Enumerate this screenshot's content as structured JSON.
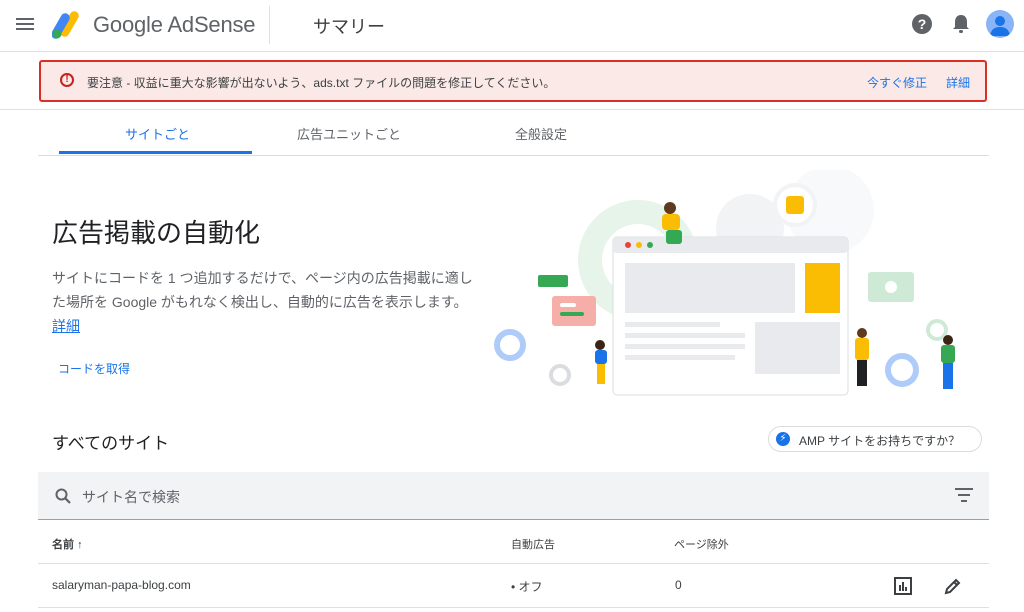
{
  "header": {
    "brand": "Google AdSense",
    "page_title": "サマリー",
    "help_symbol": "?",
    "icons": [
      "menu-icon",
      "adsense-logo-icon",
      "help-icon",
      "bell-icon",
      "avatar-icon"
    ]
  },
  "alert": {
    "message": "要注意 - 収益に重大な影響が出ないよう、ads.txt ファイルの問題を修正してください。",
    "fix_now": "今すぐ修正",
    "details": "詳細",
    "symbol": "!",
    "color": "#d93025"
  },
  "tabs": [
    {
      "label": "サイトごと",
      "active": true
    },
    {
      "label": "広告ユニットごと",
      "active": false
    },
    {
      "label": "全般設定",
      "active": false
    }
  ],
  "hero": {
    "title": "広告掲載の自動化",
    "description": "サイトにコードを 1 つ追加するだけで、ページ内の広告掲載に適した場所を Google がもれなく検出し、自動的に広告を表示します。",
    "details_link": "詳細",
    "get_code": "コードを取得"
  },
  "sites": {
    "title": "すべてのサイト",
    "amp_chip": "AMP サイトをお持ちですか？",
    "search_placeholder": "サイト名で検索",
    "columns": [
      "名前",
      "自動広告",
      "ページ除外"
    ],
    "sort_arrow": "↑",
    "rows": [
      {
        "name": "salaryman-papa-blog.com",
        "auto_ads": "• オフ",
        "page_exclusions": "0"
      }
    ]
  },
  "colors": {
    "accent": "#1a73e8",
    "alert_border": "#d93025",
    "alert_bg": "#fbe9e7",
    "logo_yellow": "#fbbc04",
    "logo_blue": "#4285f4",
    "logo_green": "#34a853"
  }
}
